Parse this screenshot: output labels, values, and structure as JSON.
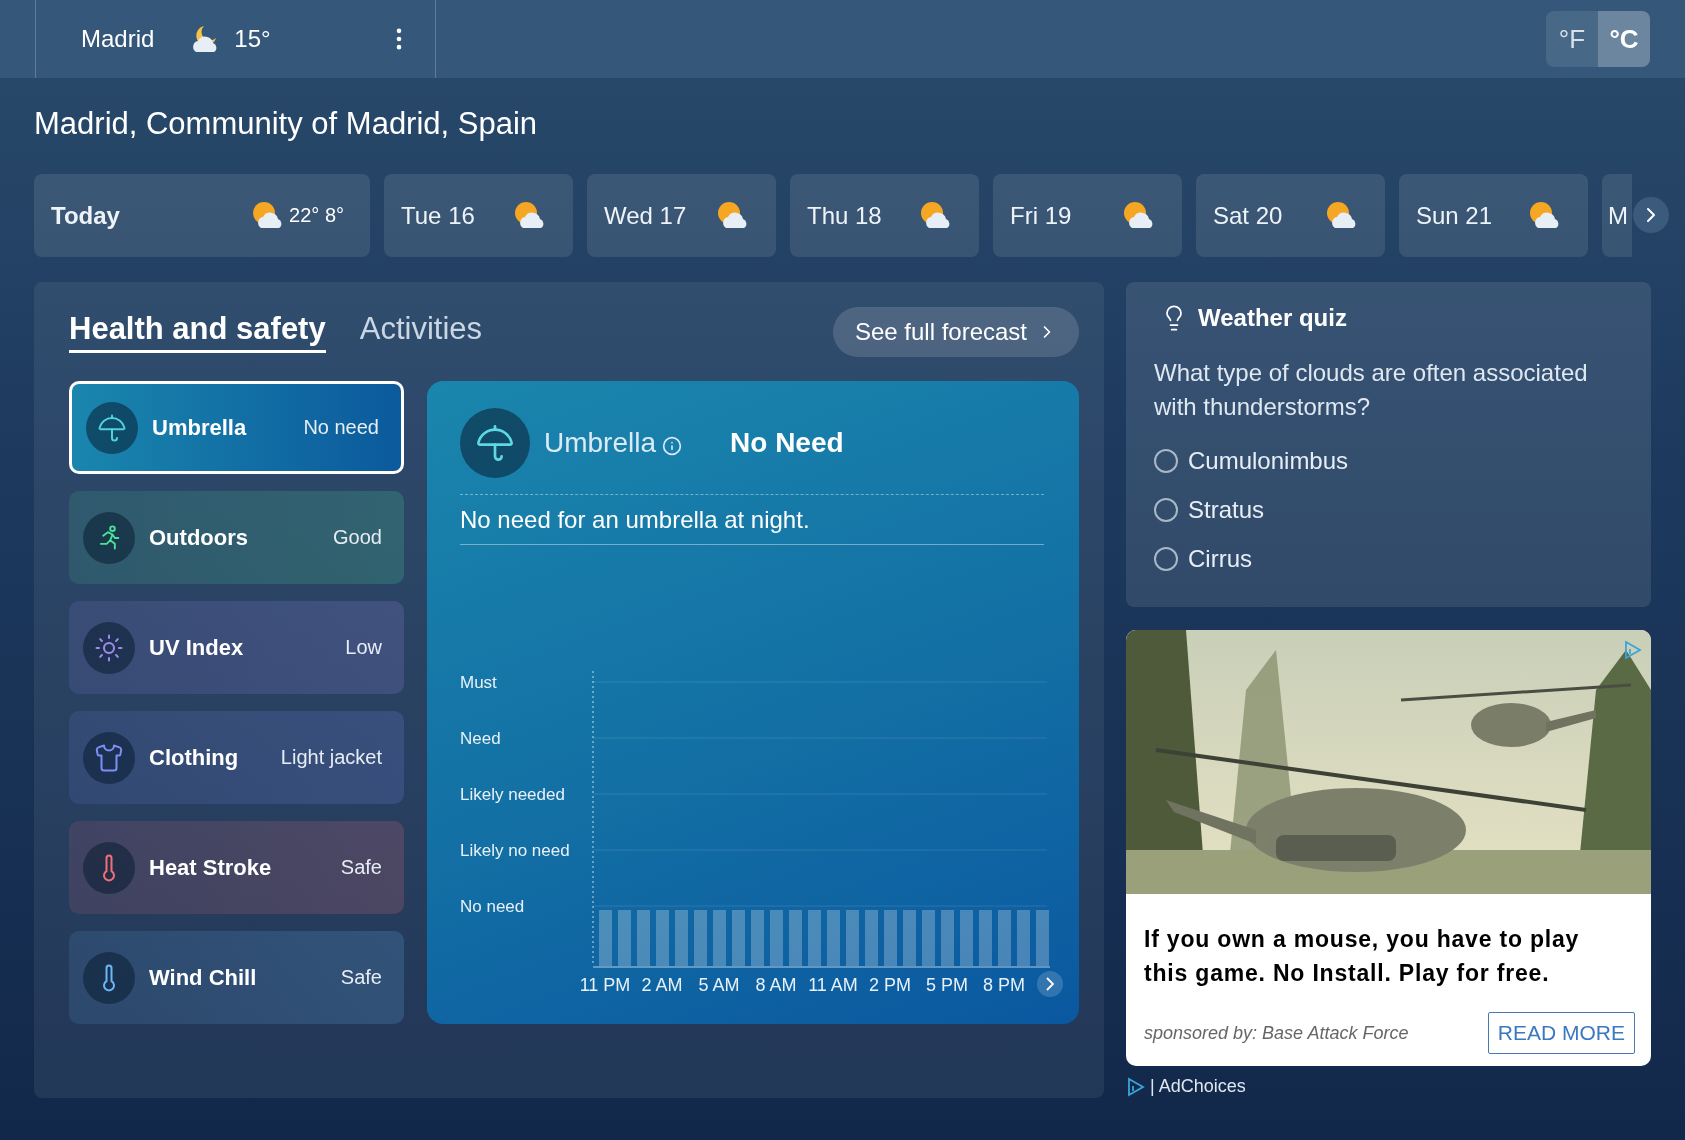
{
  "top_bar": {
    "city": "Madrid",
    "temperature": "15°",
    "units": [
      {
        "label": "°F",
        "selected": false
      },
      {
        "label": "°C",
        "selected": true
      }
    ]
  },
  "location": "Madrid, Community of Madrid, Spain",
  "days": [
    {
      "label": "Today",
      "high": "22°",
      "low": "8°",
      "icon": true
    },
    {
      "label": "Tue 16",
      "icon": true
    },
    {
      "label": "Wed 17",
      "icon": true
    },
    {
      "label": "Thu 18",
      "icon": true
    },
    {
      "label": "Fri 19",
      "icon": true
    },
    {
      "label": "Sat 20",
      "icon": true
    },
    {
      "label": "Sun 21",
      "icon": true
    },
    {
      "label": "M",
      "icon": false
    }
  ],
  "tabs": [
    {
      "label": "Health and safety",
      "selected": true
    },
    {
      "label": "Activities",
      "selected": false
    }
  ],
  "forecast_button": "See full forecast",
  "health_items": [
    {
      "kind": "umbrella",
      "name": "Umbrella",
      "status": "No need",
      "color": "#4fd1e0",
      "selected": true
    },
    {
      "kind": "outdoors",
      "name": "Outdoors",
      "status": "Good",
      "color": "#4be39a",
      "selected": false
    },
    {
      "kind": "uv",
      "name": "UV Index",
      "status": "Low",
      "color": "#a08cf0",
      "selected": false
    },
    {
      "kind": "clothing",
      "name": "Clothing",
      "status": "Light jacket",
      "color": "#7d8ff5",
      "selected": false
    },
    {
      "kind": "heat",
      "name": "Heat Stroke",
      "status": "Safe",
      "color": "#f0707a",
      "selected": false
    },
    {
      "kind": "cold",
      "name": "Wind Chill",
      "status": "Safe",
      "color": "#6ab8f5",
      "selected": false
    }
  ],
  "detail": {
    "kind": "umbrella",
    "title": "Umbrella",
    "verdict": "No Need",
    "description": "No need for an umbrella at night.",
    "chart": {
      "levels": [
        "Must",
        "Need",
        "Likely needed",
        "Likely no need",
        "No need"
      ],
      "hours": [
        "11 PM",
        "2 AM",
        "5 AM",
        "8 AM",
        "11 AM",
        "2 PM",
        "5 PM",
        "8 PM"
      ]
    }
  },
  "quiz": {
    "title": "Weather quiz",
    "question": "What type of clouds are often associated with thunderstorms?",
    "options": [
      {
        "label": "Cumulonimbus",
        "selected": false
      },
      {
        "label": "Stratus",
        "selected": false
      },
      {
        "label": "Cirrus",
        "selected": false
      }
    ]
  },
  "ad": {
    "headline": "If you own a mouse, you have to play this game. No Install. Play for free.",
    "sponsor": "sponsored by: Base Attack Force",
    "button": "READ MORE",
    "adchoices": "| AdChoices"
  }
}
